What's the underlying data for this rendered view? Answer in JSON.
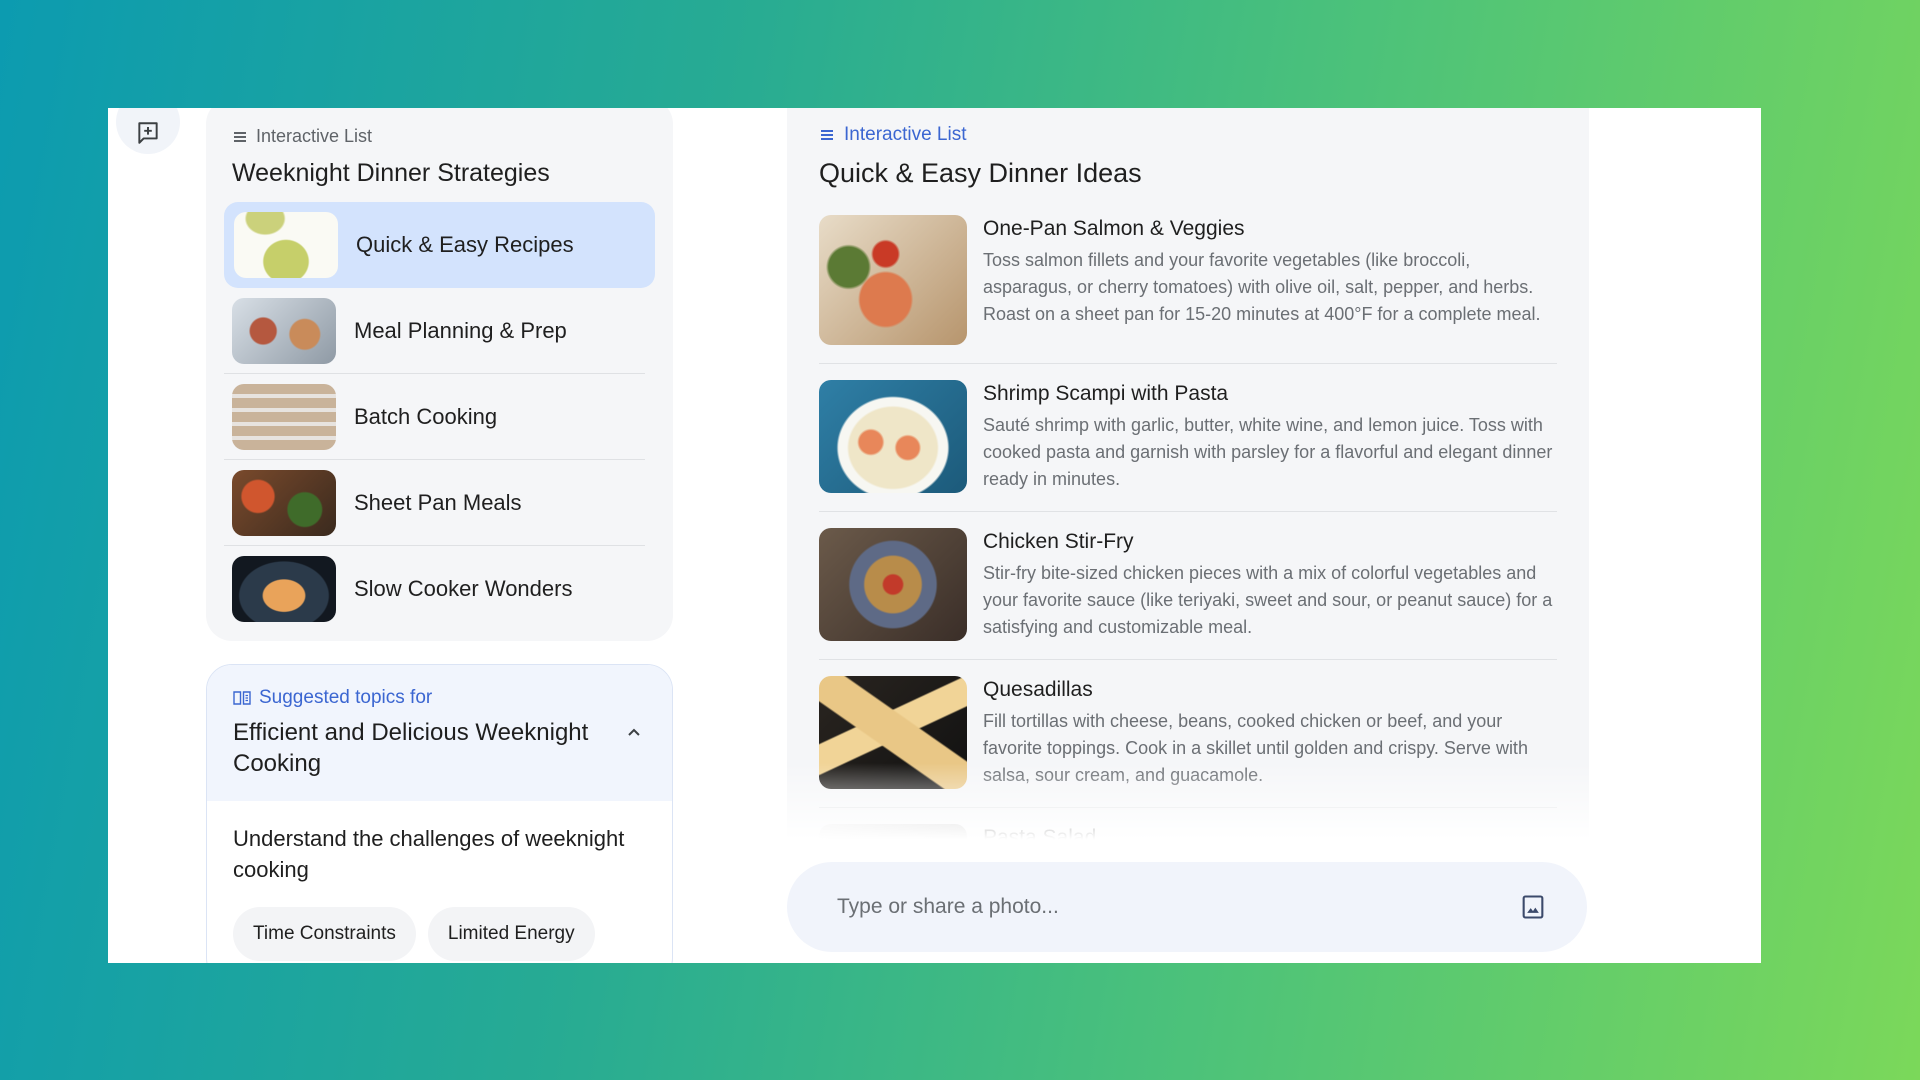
{
  "toolbar": {
    "new_chat_icon": "new-chat-icon"
  },
  "left_list": {
    "eyebrow": "Interactive List",
    "title": "Weeknight Dinner Strategies",
    "items": [
      {
        "label": "Quick & Easy Recipes",
        "selected": true
      },
      {
        "label": "Meal Planning & Prep",
        "selected": false
      },
      {
        "label": "Batch Cooking",
        "selected": false
      },
      {
        "label": "Sheet Pan Meals",
        "selected": false
      },
      {
        "label": "Slow Cooker Wonders",
        "selected": false
      }
    ]
  },
  "suggested": {
    "eyebrow": "Suggested topics for",
    "title": "Efficient and Delicious Weeknight Cooking",
    "question": "Understand the challenges of weeknight cooking",
    "chips": [
      "Time Constraints",
      "Limited Energy"
    ]
  },
  "right_list": {
    "eyebrow": "Interactive List",
    "title": "Quick & Easy Dinner Ideas",
    "items": [
      {
        "name": "One-Pan Salmon & Veggies",
        "desc": "Toss salmon fillets and your favorite vegetables (like broccoli, asparagus, or cherry tomatoes) with olive oil, salt, pepper, and herbs. Roast on a sheet pan for 15-20 minutes at 400°F for a complete meal."
      },
      {
        "name": "Shrimp Scampi with Pasta",
        "desc": "Sauté shrimp with garlic, butter, white wine, and lemon juice. Toss with cooked pasta and garnish with parsley for a flavorful and elegant dinner ready in minutes."
      },
      {
        "name": "Chicken Stir-Fry",
        "desc": "Stir-fry bite-sized chicken pieces with a mix of colorful vegetables and your favorite sauce (like teriyaki, sweet and sour, or peanut sauce) for a satisfying and customizable meal."
      },
      {
        "name": "Quesadillas",
        "desc": "Fill tortillas with cheese, beans, cooked chicken or beef, and your favorite toppings. Cook in a skillet until golden and crispy. Serve with salsa, sour cream, and guacamole."
      },
      {
        "name": "Pasta Salad",
        "desc": ""
      }
    ]
  },
  "composer": {
    "placeholder": "Type or share a photo...",
    "value": ""
  },
  "colors": {
    "accent": "#3b66d1",
    "selected_bg": "#d3e3fd",
    "panel_bg": "#f5f6f8"
  }
}
